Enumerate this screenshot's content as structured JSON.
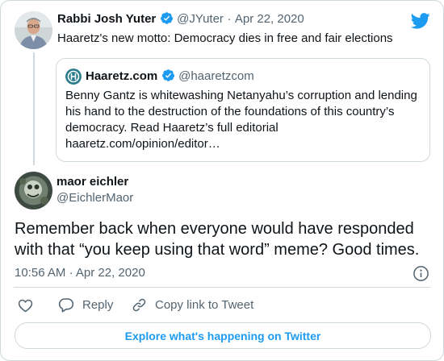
{
  "parent_tweet": {
    "author_name": "Rabbi Josh Yuter",
    "author_handle": "@JYuter",
    "separator": "·",
    "date": "Apr 22, 2020",
    "text": "Haaretz's new motto: Democracy dies in free and fair elections",
    "verified_color": "#1d9bf0"
  },
  "quoted_tweet": {
    "author_name": "Haaretz.com",
    "author_handle": "@haaretzcom",
    "lines": [
      "Benny Gantz is whitewashing Netanyahu’s corruption and lending",
      "his hand to the destruction of the foundations of this country’s",
      "democracy. Read Haaretz’s full editorial",
      "haaretz.com/opinion/editor…"
    ]
  },
  "main_tweet": {
    "author_name": "maor eichler",
    "author_handle": "@EichlerMaor",
    "lines": [
      "Remember back when everyone would have responded",
      "with that “you keep using that word” meme? Good times."
    ],
    "time": "10:56 AM",
    "separator": "·",
    "date": "Apr 22, 2020"
  },
  "actions": {
    "reply_label": "Reply",
    "copy_link_label": "Copy link to Tweet"
  },
  "explore_label": "Explore what's happening on Twitter",
  "colors": {
    "brand_blue": "#1d9bf0",
    "muted": "#536471",
    "border": "#cfd9de"
  }
}
